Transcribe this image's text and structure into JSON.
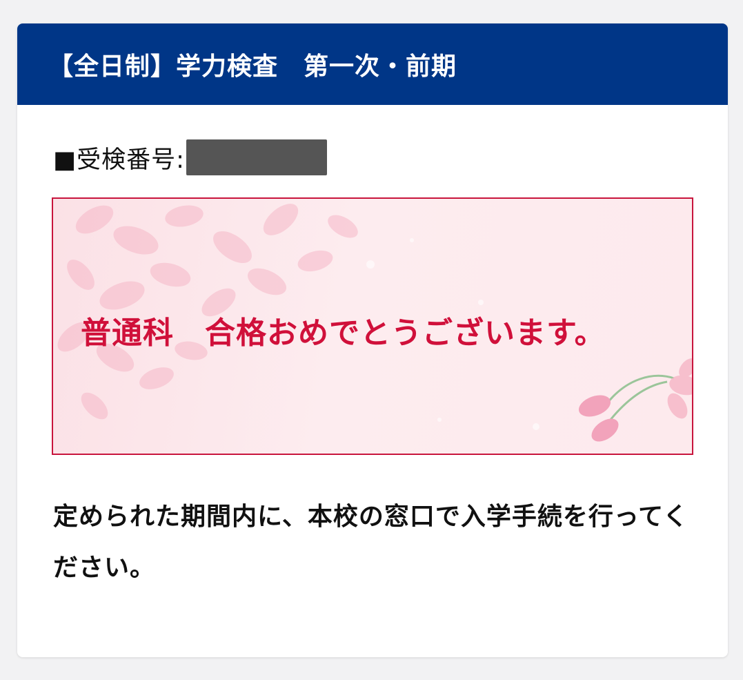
{
  "header": {
    "title": "【全日制】学力検査　第一次・前期"
  },
  "exam": {
    "label": "■受検番号:",
    "number": ""
  },
  "result": {
    "message": "普通科　合格おめでとうございます。"
  },
  "instruction": {
    "text": "定められた期間内に、本校の窓口で入学手続を行ってください。"
  },
  "colors": {
    "header_bg": "#003687",
    "accent_red": "#d0103a",
    "box_border": "#c8143c",
    "petal_pink": "#f6b8c8"
  }
}
